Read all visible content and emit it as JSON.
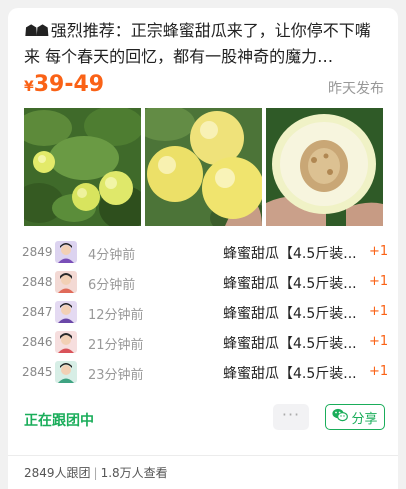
{
  "post": {
    "deco": "☗☗",
    "title": "强烈推荐：正宗蜂蜜甜瓜来了，让你停不下嘴来 每个春天的回忆，都有一股神奇的魔力…",
    "price_symbol": "¥",
    "price_range": "39-49",
    "posted": "昨天发布"
  },
  "orders": [
    {
      "num": "2849",
      "time": "4分钟前",
      "product": "蜂蜜甜瓜【4.5斤装...",
      "qty": "+1"
    },
    {
      "num": "2848",
      "time": "6分钟前",
      "product": "蜂蜜甜瓜【4.5斤装...",
      "qty": "+1"
    },
    {
      "num": "2847",
      "time": "12分钟前",
      "product": "蜂蜜甜瓜【4.5斤装...",
      "qty": "+1"
    },
    {
      "num": "2846",
      "time": "21分钟前",
      "product": "蜂蜜甜瓜【4.5斤装...",
      "qty": "+1"
    },
    {
      "num": "2845",
      "time": "23分钟前",
      "product": "蜂蜜甜瓜【4.5斤装...",
      "qty": "+1"
    }
  ],
  "actions": {
    "following": "正在跟团中",
    "more": "···",
    "share": "分享"
  },
  "stats": {
    "joined": "2849人跟团",
    "separator": "|",
    "views": "1.8万人查看"
  },
  "colors": {
    "price": "#fa6216",
    "green": "#1aad5a"
  }
}
